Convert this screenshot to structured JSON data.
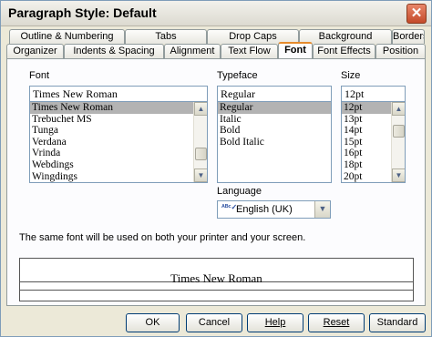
{
  "window": {
    "title": "Paragraph Style: Default",
    "close_label": "✕"
  },
  "tabs_back": [
    "Outline & Numbering",
    "Tabs",
    "Drop Caps",
    "Background",
    "Borders"
  ],
  "tabs_front": [
    "Organizer",
    "Indents & Spacing",
    "Alignment",
    "Text Flow",
    "Font",
    "Font Effects",
    "Position"
  ],
  "active_tab": "Font",
  "font": {
    "label": "Font",
    "value": "Times New Roman",
    "items": [
      "Times New Roman",
      "Trebuchet MS",
      "Tunga",
      "Verdana",
      "Vrinda",
      "Webdings",
      "Wingdings"
    ],
    "selected": "Times New Roman"
  },
  "typeface": {
    "label": "Typeface",
    "value": "Regular",
    "items": [
      "Regular",
      "Italic",
      "Bold",
      "Bold Italic"
    ],
    "selected": "Regular"
  },
  "size": {
    "label": "Size",
    "value": "12pt",
    "items": [
      "12pt",
      "13pt",
      "14pt",
      "15pt",
      "16pt",
      "18pt",
      "20pt"
    ],
    "selected": "12pt"
  },
  "language": {
    "label": "Language",
    "value": "English (UK)",
    "icon": "abc-spellcheck-icon"
  },
  "info_text": "The same font will be used on both your printer and your screen.",
  "preview_text": "Times New Roman",
  "buttons": {
    "ok": "OK",
    "cancel": "Cancel",
    "help": "Help",
    "reset": "Reset",
    "standard": "Standard"
  }
}
